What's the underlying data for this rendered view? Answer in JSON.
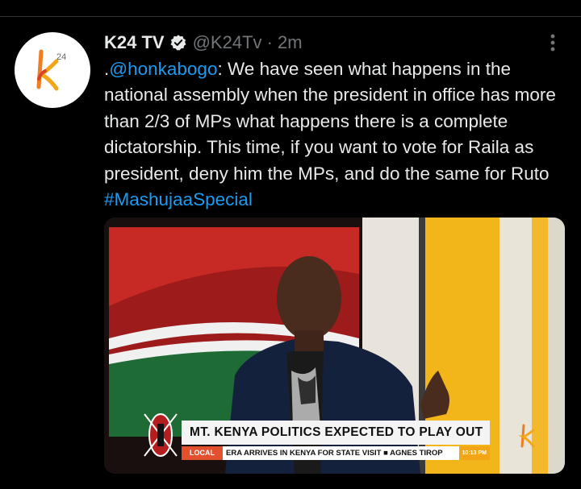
{
  "tweet": {
    "author_name": "K24 TV",
    "handle_time": "@K24Tv · 2m",
    "mention": "@honkabogo",
    "text_prefix": ".",
    "text_body": ": We have seen what happens in the national assembly when the president in office has more than 2/3 of MPs what happens there is a complete dictatorship. This time, if you want to vote for Raila as president, deny him the MPs, and do the same for Ruto ",
    "hashtag": "#MashujaaSpecial"
  },
  "avatar": {
    "logo_text": "24"
  },
  "media": {
    "headline": "MT. KENYA POLITICS EXPECTED TO PLAY OUT",
    "ticker_tag": "LOCAL",
    "ticker_text": "ERA ARRIVES IN KENYA FOR STATE VISIT ■ AGNES TIROP",
    "clock": "10:13 PM"
  },
  "colors": {
    "accent": "#1d9bf0",
    "background": "#000000",
    "text": "#e7e9ea",
    "muted": "#71767b"
  },
  "icons": {
    "verified": "verified-badge-icon",
    "more": "more-vertical-icon"
  }
}
